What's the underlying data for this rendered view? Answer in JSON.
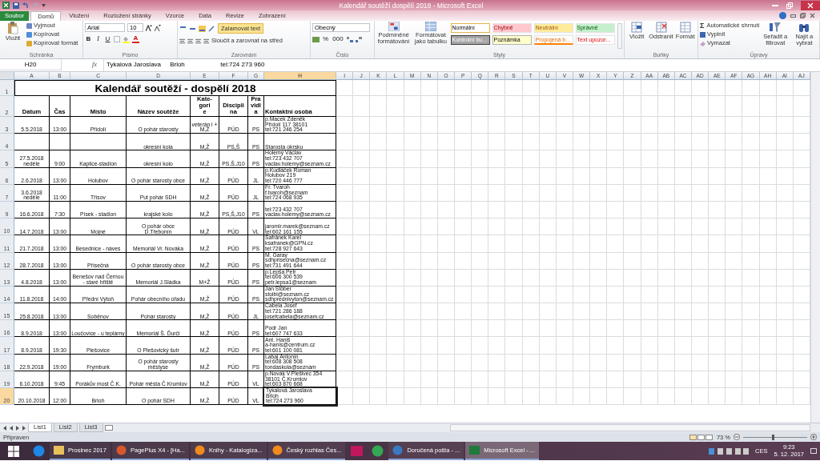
{
  "window": {
    "title": "Kalendář soutěží dospělí 2018 - Microsoft Excel"
  },
  "tabs": [
    {
      "label": "Soubor",
      "kind": "file",
      "selected": false
    },
    {
      "label": "Domů",
      "kind": "tab",
      "selected": true
    },
    {
      "label": "Vložení",
      "kind": "tab",
      "selected": false
    },
    {
      "label": "Rozložení stránky",
      "kind": "tab",
      "selected": false
    },
    {
      "label": "Vzorce",
      "kind": "tab",
      "selected": false
    },
    {
      "label": "Data",
      "kind": "tab",
      "selected": false
    },
    {
      "label": "Revize",
      "kind": "tab",
      "selected": false
    },
    {
      "label": "Zobrazení",
      "kind": "tab",
      "selected": false
    }
  ],
  "ribbon": {
    "clipboard": {
      "label": "Schránka",
      "paste": "Vložit",
      "items": [
        "Vyjmout",
        "Kopírovat",
        "Kopírovat formát"
      ]
    },
    "font": {
      "label": "Písmo",
      "family": "Arial",
      "size": "10",
      "styles": [
        "B",
        "I",
        "U"
      ],
      "color_letter": "A"
    },
    "alignment": {
      "label": "Zarovnání",
      "wrap": {
        "label": "Zalamovat text",
        "on": true
      },
      "merge": "Sloučit a zarovnat na střed"
    },
    "number": {
      "label": "Číslo",
      "format": "Obecný",
      "percent": "%",
      "thousands": "000"
    },
    "styles": {
      "label": "Styly",
      "conditional": "Podmíněné formátování",
      "as_table": "Formátovat jako tabulku",
      "gallery": [
        {
          "label": "Normální",
          "kind": "normal",
          "selected": true
        },
        {
          "label": "Chybně",
          "kind": "bad",
          "selected": false
        },
        {
          "label": "Neutrální",
          "kind": "neutral",
          "selected": false
        },
        {
          "label": "Správně",
          "kind": "good",
          "selected": false
        },
        {
          "label": "Kontrolní bu...",
          "kind": "check",
          "selected": false
        },
        {
          "label": "Poznámka",
          "kind": "note",
          "selected": false
        },
        {
          "label": "Propojená b...",
          "kind": "linked",
          "selected": false
        },
        {
          "label": "Text upozor...",
          "kind": "warning",
          "selected": false
        }
      ]
    },
    "cells": {
      "label": "Buňky",
      "items": [
        "Vložit",
        "Odstranit",
        "Formát"
      ]
    },
    "editing": {
      "label": "Úpravy",
      "sum_sign": "Σ",
      "items": [
        "Automatické shrnutí",
        "Vyplnit",
        "Vymazat"
      ],
      "big": [
        "Seřadit a filtrovat",
        "Najít a vybrat"
      ]
    }
  },
  "formula_bar": {
    "cell": "H20",
    "fx": "fx",
    "value": "Tykalová Jaroslava     Brloh                    tel:724 273 960"
  },
  "sheet": {
    "columns": [
      {
        "label": "A",
        "selected": false
      },
      {
        "label": "B",
        "selected": false
      },
      {
        "label": "C",
        "selected": false
      },
      {
        "label": "D",
        "selected": false
      },
      {
        "label": "E",
        "selected": false
      },
      {
        "label": "F",
        "selected": false
      },
      {
        "label": "G",
        "selected": false
      },
      {
        "label": "H",
        "selected": true
      }
    ],
    "extra_columns": [
      "I",
      "J",
      "K",
      "L",
      "M",
      "N",
      "O",
      "P",
      "Q",
      "R",
      "S",
      "T",
      "U",
      "V",
      "W",
      "X",
      "Y",
      "Z",
      "AA",
      "AB",
      "AC",
      "AD",
      "AE",
      "AF",
      "AG",
      "AH",
      "AI",
      "AJ"
    ],
    "title_row": "1",
    "title": "Kalendář soutěží - dospělí 2018",
    "header_row": "2",
    "headers": [
      "Datum",
      "Čas",
      "Místo",
      "Název soutěže",
      "Kate-\ngori\ne",
      "Discipli\nna",
      "Pra\nvidl\na",
      "Kontaktní osoba"
    ],
    "rows": [
      {
        "row": "3",
        "selected": false,
        "cells": [
          "5.5.2018",
          "13:00",
          "Přídolí",
          "O pohár starosty",
          "veterán i + M,Ž",
          "PÚD",
          "PS",
          "p.Macek Zdeněk\nPřídolí 117  38101\ntel:721 246 254"
        ]
      },
      {
        "row": "4",
        "selected": false,
        "cells": [
          "",
          "",
          "",
          "okresní kola",
          "M,Ž",
          "PS,Š",
          "PS",
          "Starosta okrsku"
        ]
      },
      {
        "row": "5",
        "selected": false,
        "cells": [
          "27.5.2018\nneděle",
          "9:00",
          "Kaplice-stadion",
          "okresní kolo",
          "M,Ž",
          "PS,Š,J10",
          "PS",
          "Holemý Václav\ntel:723 432 707\nvaclav.holemy@seznam.cz"
        ]
      },
      {
        "row": "6",
        "selected": false,
        "cells": [
          "2.6.2018",
          "13:00",
          "Holubov",
          "O pohár starosty obce",
          "M,Ž",
          "PÚD",
          "JL",
          "p.Kudláček Roman\nHolubov 219\ntel:720 446 777"
        ]
      },
      {
        "row": "7",
        "selected": false,
        "cells": [
          "3.6.2018\nneděle",
          "11:00",
          "Třísov",
          "Put pohár SDH",
          "M,Ž",
          "PÚD",
          "JL",
          "Fr. Tvaroh\nf.tvaroh@seznam\ntel:724 068 935"
        ]
      },
      {
        "row": "9",
        "selected": false,
        "cells": [
          "16.6.2018",
          "7:30",
          "Písek - stadion",
          "krajské kolo",
          "M,Ž",
          "PS,Š,J10",
          "PS",
          "tel:723 432 707\nvaclav.holemy@seznam.cz"
        ]
      },
      {
        "row": "10",
        "selected": false,
        "cells": [
          "14.7.2018",
          "13:00",
          "Mojné",
          "O pohár obce D.Třebonín",
          "M,Ž",
          "PÚD",
          "VL",
          "jaromir.marek@seznam.cz tel:602 161 155"
        ]
      },
      {
        "row": "11",
        "selected": false,
        "cells": [
          "21.7.2018",
          "13:00",
          "Besednice - náves",
          "Memoriál Vr. Nováka",
          "M,Ž",
          "PÚD",
          "PS",
          "Šafránek Karel\nksafranek@GPN.cz\ntel:728 927 643"
        ]
      },
      {
        "row": "12",
        "selected": false,
        "cells": [
          "28.7.2018",
          "13:00",
          "Přísečná",
          "O pohár starosty obce",
          "M,Ž",
          "PÚD",
          "PS",
          "M. Garay\nsdhprisecna@seznam.cz\ntel:731 491 644"
        ]
      },
      {
        "row": "13",
        "selected": false,
        "cells": [
          "4.8.2018",
          "13:00",
          "Benešov nad Černou - staré hřiště",
          "Memoriál J.Sládka",
          "M+Ž",
          "PÚD",
          "PS",
          "p.Lepša Petr\ntel:606 300 539\npetr.lepsa1@seznam"
        ]
      },
      {
        "row": "14",
        "selected": false,
        "cells": [
          "11.8.2018",
          "14:00",
          "Přední Výtoň",
          "Pohár obecního úřadu",
          "M,Ž",
          "PÚD",
          "PS",
          "Jan Stöber\nstoibi@seznam.cz\nsdhprednivyton@seznam.cz"
        ]
      },
      {
        "row": "15",
        "selected": false,
        "cells": [
          "25.8.2018",
          "13:00",
          "Soběnov",
          "Pohár starosty",
          "M,Ž",
          "PÚD",
          "JL",
          "Čabela Josef\ntel:721 286 188\njosefcabela@seznam.cz"
        ]
      },
      {
        "row": "16",
        "selected": false,
        "cells": [
          "8.9.2018",
          "13:00",
          "Loučovice - u teplárny",
          "Memoriál Š. Ďurči",
          "M,Ž",
          "PÚD",
          "PS",
          "Podr Jan\ntel:607 747 633"
        ]
      },
      {
        "row": "17",
        "selected": false,
        "cells": [
          "8.9.2018",
          "19:30",
          "Plešovice",
          "O Plešovický šutr",
          "M,Ž",
          "PÚD",
          "PS",
          "Ant. Haniš\na-hanis@centrum.cz\ntel:601 100 081"
        ]
      },
      {
        "row": "18",
        "selected": false,
        "cells": [
          "22.9.2018",
          "19:00",
          "Frymburk",
          "O pohár starosty městyse",
          "M,Ž",
          "PÚD",
          "PS",
          "Labaj Antonín\ntel:608 308 508\ntondaskola@seznam"
        ]
      },
      {
        "row": "19",
        "selected": false,
        "cells": [
          "6.10.2018",
          "9:45",
          "Porákův most Č.K.",
          "Pohár města Č.Krumlov",
          "M,Ž",
          "PÚD",
          "VL",
          "p.Novák V.Plešivec 354\n38101 Č.Krumlov\ntel:603 870 668"
        ]
      },
      {
        "row": "20",
        "selected": true,
        "cells": [
          "20.10.2018",
          "12:00",
          "Brloh",
          "O pohár SDH",
          "M,Ž",
          "PÚD",
          "VL",
          "Tykalová Jaroslava\nBrloh\ntel:724 273 960"
        ]
      }
    ]
  },
  "sheet_tabs": [
    {
      "label": "List1",
      "selected": true
    },
    {
      "label": "List2",
      "selected": false
    },
    {
      "label": "List3",
      "selected": false
    }
  ],
  "status": {
    "text": "Připraven",
    "zoom": "73 %",
    "zoom_slider": {
      "level": 0.46
    }
  },
  "taskbar": {
    "items": [
      {
        "kind": "pinned",
        "selected": false
      },
      {
        "kind": "window",
        "label": "Prosinec 2017",
        "selected": false
      },
      {
        "kind": "window",
        "label": "PagePlus X4 - [Ha...",
        "selected": false
      },
      {
        "kind": "window",
        "label": "Knihy - Katalogiza...",
        "selected": false
      },
      {
        "kind": "window",
        "label": "Český rozhlas Čes...",
        "selected": false
      },
      {
        "kind": "pinned",
        "selected": false
      },
      {
        "kind": "pinned",
        "selected": false
      },
      {
        "kind": "window",
        "label": "Doručená pošta - ...",
        "selected": false
      },
      {
        "kind": "window",
        "label": "Microsoft Excel - ...",
        "selected": true
      }
    ],
    "language": "CES",
    "time": "9:23",
    "date": "5. 12. 2017"
  }
}
